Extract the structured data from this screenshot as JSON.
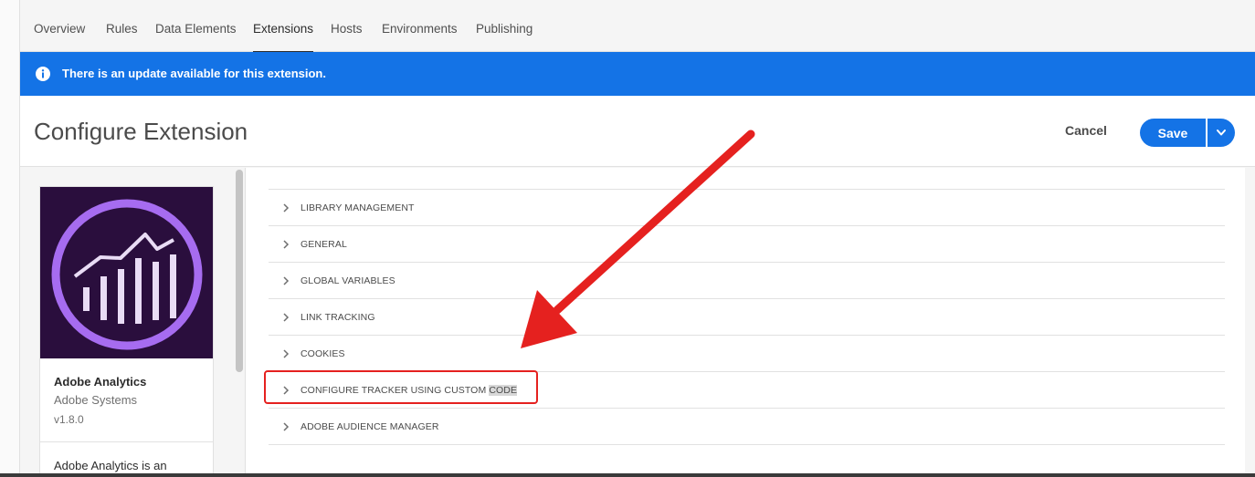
{
  "nav": {
    "tabs": [
      {
        "label": "Overview",
        "active": false
      },
      {
        "label": "Rules",
        "active": false
      },
      {
        "label": "Data Elements",
        "active": false
      },
      {
        "label": "Extensions",
        "active": true
      },
      {
        "label": "Hosts",
        "active": false
      },
      {
        "label": "Environments",
        "active": false
      },
      {
        "label": "Publishing",
        "active": false
      }
    ]
  },
  "banner": {
    "text": "There is an update available for this extension.",
    "color": "#1473e6",
    "icon": "info-icon"
  },
  "header": {
    "title": "Configure Extension",
    "cancel_label": "Cancel",
    "save_label": "Save"
  },
  "extension": {
    "name": "Adobe Analytics",
    "vendor": "Adobe Systems",
    "version": "v1.8.0",
    "description": "Adobe Analytics is an",
    "logo_icon": "adobe-analytics-logo"
  },
  "sections": [
    {
      "label": "LIBRARY MANAGEMENT"
    },
    {
      "label": "GENERAL"
    },
    {
      "label": "GLOBAL VARIABLES"
    },
    {
      "label": "LINK TRACKING"
    },
    {
      "label": "COOKIES"
    },
    {
      "label_prefix": "CONFIGURE TRACKER USING CUSTOM ",
      "label_highlight": "CODE"
    },
    {
      "label": "ADOBE AUDIENCE MANAGER"
    }
  ],
  "annotation": {
    "color": "#e5211f"
  }
}
